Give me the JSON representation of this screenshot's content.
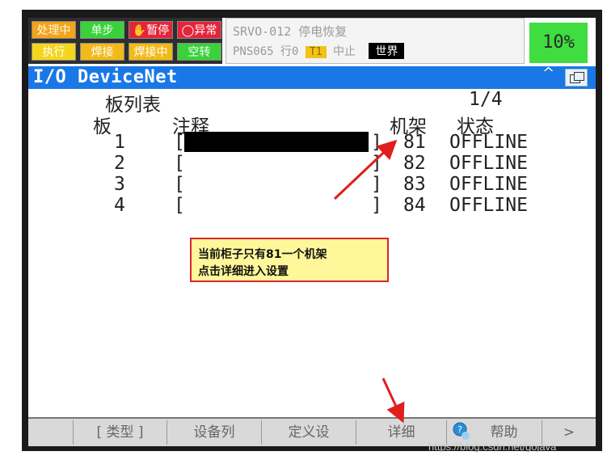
{
  "status_lamps": {
    "processing": "处理中",
    "single_step": "单步",
    "hold": "暂停",
    "fault": "异常",
    "run": "执行",
    "weld": "焊接",
    "welding": "焊接中",
    "dry_run": "空转"
  },
  "alarm": {
    "code": "SRVO-012 停电恢复",
    "program": "PNS065",
    "line_label": "行0",
    "mode": "T1",
    "state": "中止",
    "coord": "世界"
  },
  "override": "10%",
  "title": "I/O DeviceNet",
  "title_caret": "^",
  "board_list": {
    "heading": "板列表",
    "page": "1/4",
    "col_board": "板",
    "col_comment": "注释",
    "col_rack": "机架",
    "col_status": "状态",
    "rows": [
      {
        "board": "1",
        "open": "[",
        "close": "]",
        "rack": "81",
        "status": "OFFLINE"
      },
      {
        "board": "2",
        "open": "[",
        "close": "]",
        "rack": "82",
        "status": "OFFLINE"
      },
      {
        "board": "3",
        "open": "[",
        "close": "]",
        "rack": "83",
        "status": "OFFLINE"
      },
      {
        "board": "4",
        "open": "[",
        "close": "]",
        "rack": "84",
        "status": "OFFLINE"
      }
    ]
  },
  "callout": {
    "line1": "当前柜子只有81一个机架",
    "line2": "点击详细进入设置"
  },
  "softkeys": {
    "type": "[ 类型 ]",
    "device_list": "设备列",
    "define": "定义设",
    "detail": "详细",
    "help": "帮助",
    "next": ">"
  },
  "watermark": "https://blog.csdn.net/gojava",
  "colors": {
    "title_bar": "#1a78e6",
    "override_bg": "#3fdd3f",
    "callout_bg": "#fff79a",
    "callout_border": "#d8262e",
    "arrow": "#e01e1e"
  }
}
